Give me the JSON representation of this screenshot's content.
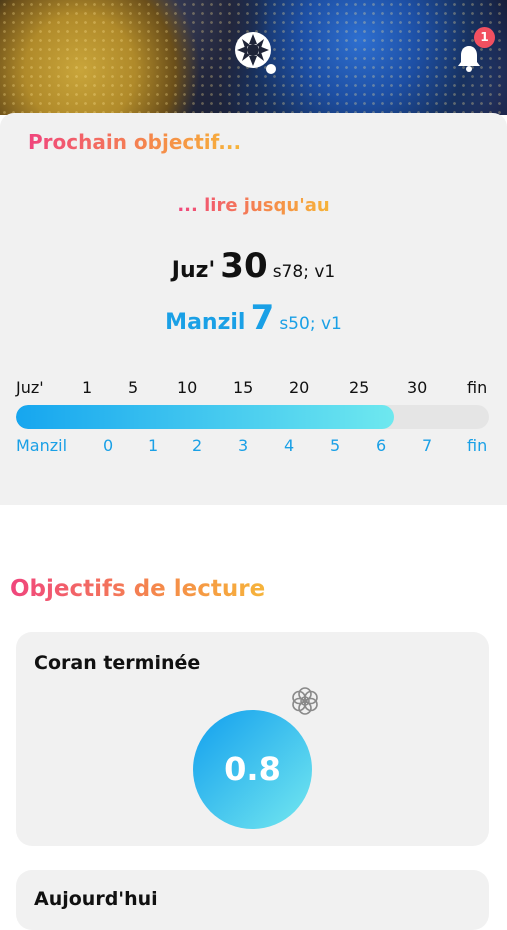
{
  "header": {
    "notifications_count": "1",
    "logo_icon": "rosette-logo-icon",
    "bell_icon": "bell-icon"
  },
  "goal": {
    "title": "Prochain objectif...",
    "read_until": "... lire jusqu'au",
    "juz_label": "Juz'",
    "juz_value": "30",
    "juz_ref": "s78; v1",
    "manzil_label": "Manzil",
    "manzil_value": "7",
    "manzil_ref": "s50; v1",
    "progress_fraction": 0.8
  },
  "juz_scale": [
    "Juz'",
    "1",
    "5",
    "10",
    "15",
    "20",
    "25",
    "30",
    "fin"
  ],
  "manzil_scale": [
    "Manzil",
    "0",
    "1",
    "2",
    "3",
    "4",
    "5",
    "6",
    "7",
    "fin"
  ],
  "reading_goals": {
    "title": "Objectifs de lecture",
    "quran_completed": {
      "label": "Coran terminée",
      "value": "0.8"
    },
    "today": {
      "label": "Aujourd'hui"
    }
  },
  "colors": {
    "accent_blue": "#1aa0e6",
    "pink": "#f0457d",
    "orange": "#f6b43a",
    "badge_red": "#f25060"
  }
}
